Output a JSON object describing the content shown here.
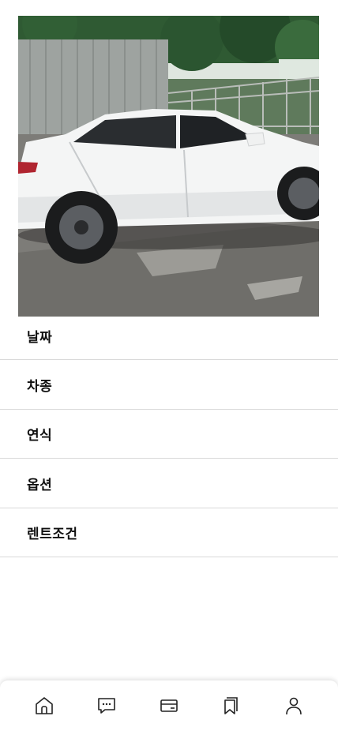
{
  "photo": {
    "subject": "white sedan parked on asphalt"
  },
  "info_rows": [
    {
      "label": "날짜"
    },
    {
      "label": "차종"
    },
    {
      "label": "연식"
    },
    {
      "label": "옵션"
    },
    {
      "label": "렌트조건"
    }
  ],
  "tabbar": {
    "items": [
      {
        "icon": "home-icon"
      },
      {
        "icon": "chat-icon"
      },
      {
        "icon": "card-icon"
      },
      {
        "icon": "bookmark-icon"
      },
      {
        "icon": "profile-icon"
      }
    ]
  },
  "colors": {
    "divider": "#d9d9d9",
    "text": "#111111",
    "icon": "#222222"
  }
}
